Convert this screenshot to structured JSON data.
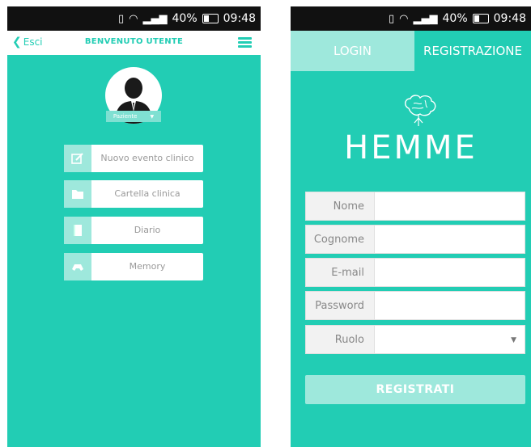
{
  "status": {
    "battery": "40%",
    "time": "09:48"
  },
  "screen1": {
    "back_label": "Esci",
    "title": "BENVENUTO UTENTE",
    "role": "Paziente",
    "menu": [
      {
        "label": "Nuovo evento clinico",
        "icon": "edit-icon"
      },
      {
        "label": "Cartella clinica",
        "icon": "folder-icon"
      },
      {
        "label": "Diario",
        "icon": "book-icon"
      },
      {
        "label": "Memory",
        "icon": "gamepad-icon"
      }
    ]
  },
  "screen2": {
    "tabs": {
      "login": "LOGIN",
      "register": "REGISTRAZIONE"
    },
    "logo": "HEMME",
    "fields": [
      "Nome",
      "Cognome",
      "E-mail",
      "Password",
      "Ruolo"
    ],
    "submit": "REGISTRATI"
  },
  "colors": {
    "accent": "#22CDB4",
    "light": "#9EE8DC"
  }
}
